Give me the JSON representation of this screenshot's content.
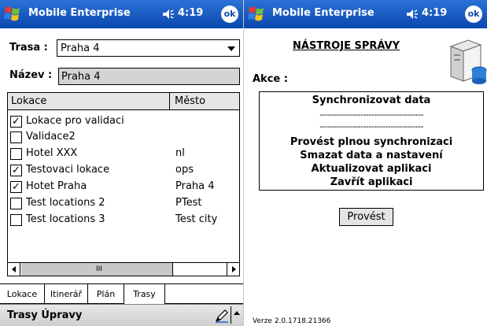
{
  "left": {
    "titlebar": {
      "title": "Mobile Enterprise",
      "time": "4:19",
      "ok": "ok"
    },
    "form": {
      "trasa_label": "Trasa :",
      "trasa_value": "Praha 4",
      "nazev_label": "Název :",
      "nazev_value": "Praha 4"
    },
    "list": {
      "columns": [
        "Lokace",
        "Město"
      ],
      "rows": [
        {
          "name": "Lokace pro validaci",
          "city": "",
          "checked": true
        },
        {
          "name": "Validace2",
          "city": "",
          "checked": false
        },
        {
          "name": "Hotel XXX",
          "city": "nl",
          "checked": false
        },
        {
          "name": "Testovaci lokace",
          "city": "ops",
          "checked": true
        },
        {
          "name": "Hotet Praha",
          "city": "Praha 4",
          "checked": true
        },
        {
          "name": "Test locations 2",
          "city": "PTest",
          "checked": false
        },
        {
          "name": "Test locations 3",
          "city": "Test city",
          "checked": false
        }
      ],
      "scroll_grip": "III"
    },
    "tabs": [
      {
        "label": "Lokace",
        "active": false
      },
      {
        "label": "Itinerář",
        "active": false
      },
      {
        "label": "Plán",
        "active": false
      },
      {
        "label": "Trasy",
        "active": true
      }
    ],
    "menubar": {
      "text": "Trasy Úpravy"
    }
  },
  "right": {
    "titlebar": {
      "title": "Mobile Enterprise",
      "time": "4:19",
      "ok": "ok"
    },
    "heading": "NÁSTROJE SPRÁVY",
    "akce_label": "Akce :",
    "actions": {
      "sync": "Synchronizovat data",
      "separator": "--------------------------------------",
      "full_sync": "Provést plnou synchronizaci",
      "delete": "Smazat data a nastavení",
      "update": "Aktualizovat aplikaci",
      "close": "Zavřít aplikaci"
    },
    "button_label": "Provést",
    "version": "Verze 2.0.1718.21366"
  },
  "colors": {
    "titlebar_top": "#2b72d6",
    "titlebar_bottom": "#0b47ae",
    "field_disabled": "#d4d4d4"
  },
  "icons": [
    "windows-start-icon",
    "speaker-icon",
    "ok-icon",
    "pen-icon",
    "server-database-icon"
  ]
}
